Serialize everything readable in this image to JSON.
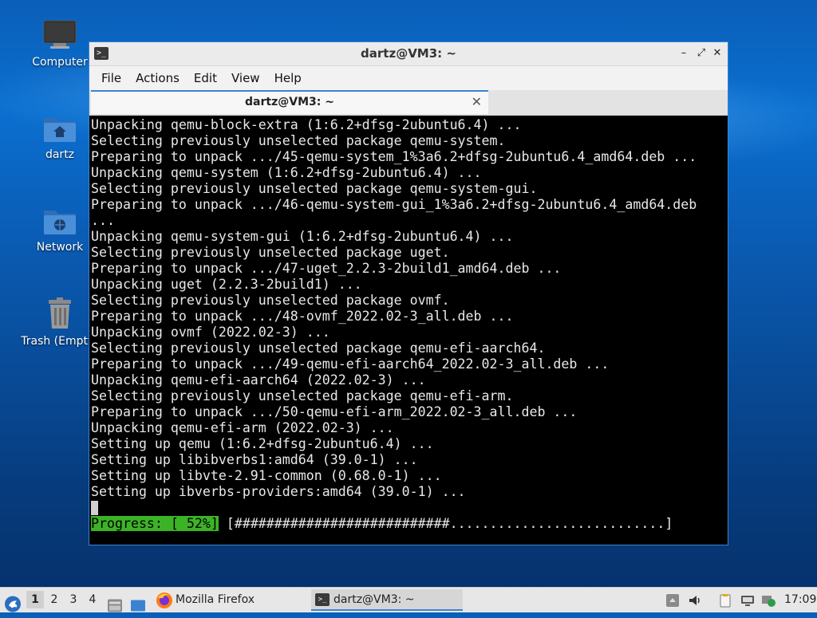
{
  "desktop": {
    "icons": [
      {
        "label": "Computer",
        "icon": "computer-icon"
      },
      {
        "label": "dartz",
        "icon": "home-folder-icon"
      },
      {
        "label": "Network",
        "icon": "network-folder-icon"
      },
      {
        "label": "Trash (Empty)",
        "icon": "trash-icon"
      }
    ]
  },
  "window": {
    "title": "dartz@VM3: ~",
    "menu": [
      "File",
      "Actions",
      "Edit",
      "View",
      "Help"
    ],
    "tab": {
      "label": "dartz@VM3: ~"
    },
    "terminal": {
      "lines": [
        "Unpacking qemu-block-extra (1:6.2+dfsg-2ubuntu6.4) ...",
        "Selecting previously unselected package qemu-system.",
        "Preparing to unpack .../45-qemu-system_1%3a6.2+dfsg-2ubuntu6.4_amd64.deb ...",
        "Unpacking qemu-system (1:6.2+dfsg-2ubuntu6.4) ...",
        "Selecting previously unselected package qemu-system-gui.",
        "Preparing to unpack .../46-qemu-system-gui_1%3a6.2+dfsg-2ubuntu6.4_amd64.deb",
        "...",
        "Unpacking qemu-system-gui (1:6.2+dfsg-2ubuntu6.4) ...",
        "Selecting previously unselected package uget.",
        "Preparing to unpack .../47-uget_2.2.3-2build1_amd64.deb ...",
        "Unpacking uget (2.2.3-2build1) ...",
        "Selecting previously unselected package ovmf.",
        "Preparing to unpack .../48-ovmf_2022.02-3_all.deb ...",
        "Unpacking ovmf (2022.02-3) ...",
        "Selecting previously unselected package qemu-efi-aarch64.",
        "Preparing to unpack .../49-qemu-efi-aarch64_2022.02-3_all.deb ...",
        "Unpacking qemu-efi-aarch64 (2022.02-3) ...",
        "Selecting previously unselected package qemu-efi-arm.",
        "Preparing to unpack .../50-qemu-efi-arm_2022.02-3_all.deb ...",
        "Unpacking qemu-efi-arm (2022.02-3) ...",
        "Setting up qemu (1:6.2+dfsg-2ubuntu6.4) ...",
        "Setting up libibverbs1:amd64 (39.0-1) ...",
        "Setting up libvte-2.91-common (0.68.0-1) ...",
        "Setting up ibverbs-providers:amd64 (39.0-1) ..."
      ],
      "progress_label": "Progress: [ 52%]",
      "progress_bar": " [###########################...........................]",
      "progress_percent": 52
    }
  },
  "taskbar": {
    "workspaces": [
      "1",
      "2",
      "3",
      "4"
    ],
    "active_workspace": "1",
    "tasks": [
      {
        "label": "Mozilla Firefox",
        "icon": "firefox-icon"
      },
      {
        "label": "dartz@VM3: ~",
        "icon": "terminal-icon"
      }
    ],
    "clock": "17:09"
  },
  "colors": {
    "accent": "#3b83d1",
    "progress_green": "#3cb326",
    "terminal_bg": "#000000"
  }
}
